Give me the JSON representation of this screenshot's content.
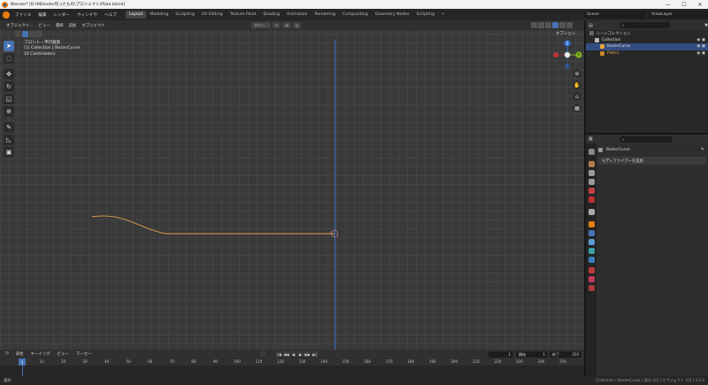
{
  "window": {
    "title": "Blender* [D:\\¥Blender作ったもの\\プロジェクト\\Plate.blend]",
    "controls": [
      "—",
      "☐",
      "✕"
    ]
  },
  "menubar": {
    "items": [
      "ファイル",
      "編集",
      "レンダー",
      "ウィンドウ",
      "ヘルプ"
    ],
    "workspaces": [
      "Layout",
      "Modeling",
      "Sculpting",
      "UV Editing",
      "Texture Paint",
      "Shading",
      "Animation",
      "Rendering",
      "Compositing",
      "Geometry Nodes",
      "Scripting",
      "+"
    ],
    "active_workspace": "Layout",
    "scene_label": "Scene",
    "view_layer_label": "ViewLayer"
  },
  "viewport": {
    "mode": "オブジェクト...",
    "menu": [
      "ビュー",
      "選択",
      "追加",
      "オブジェクト"
    ],
    "transform": "グロー...",
    "options_label": "オプション",
    "info_lines": [
      "フロント・平行投影",
      "(1) Collection | BezierCurve",
      "10 Centimeters"
    ],
    "gizmo": {
      "z": "Z",
      "y": "Y",
      "x": "X"
    },
    "colors": {
      "curve": "#e0a14a",
      "z_axis": "#3c6fbf",
      "accent": "#4772b3"
    }
  },
  "outliner": {
    "root": "シーンコレクション",
    "collection": "Collection",
    "items": [
      {
        "name": "BezierCurve",
        "selected": true
      },
      {
        "name": "Plate1",
        "selected": false
      }
    ]
  },
  "properties": {
    "object_name": "BezierCurve",
    "add_modifier_label": "モディファイアーを追加"
  },
  "timeline": {
    "menu": [
      "再生",
      "キーイング",
      "ビュー",
      "マーカー"
    ],
    "current_frame": "1",
    "start_label": "開始",
    "start_value": "1",
    "end_label": "終了",
    "end_value": "250",
    "frame_field": "1",
    "playback": [
      "|◀",
      "◀◀",
      "◀",
      "▶",
      "▶▶",
      "▶|"
    ],
    "ticks": [
      "1",
      "10",
      "20",
      "30",
      "40",
      "50",
      "60",
      "70",
      "80",
      "90",
      "100",
      "110",
      "120",
      "130",
      "140",
      "150",
      "160",
      "170",
      "180",
      "190",
      "200",
      "210",
      "220",
      "230",
      "240",
      "250"
    ]
  },
  "statusbar": {
    "left": "選択",
    "right": "Collection | BezierCurve | 頂点 2/2 | オブジェクト 1/2 | 3.3.0"
  }
}
